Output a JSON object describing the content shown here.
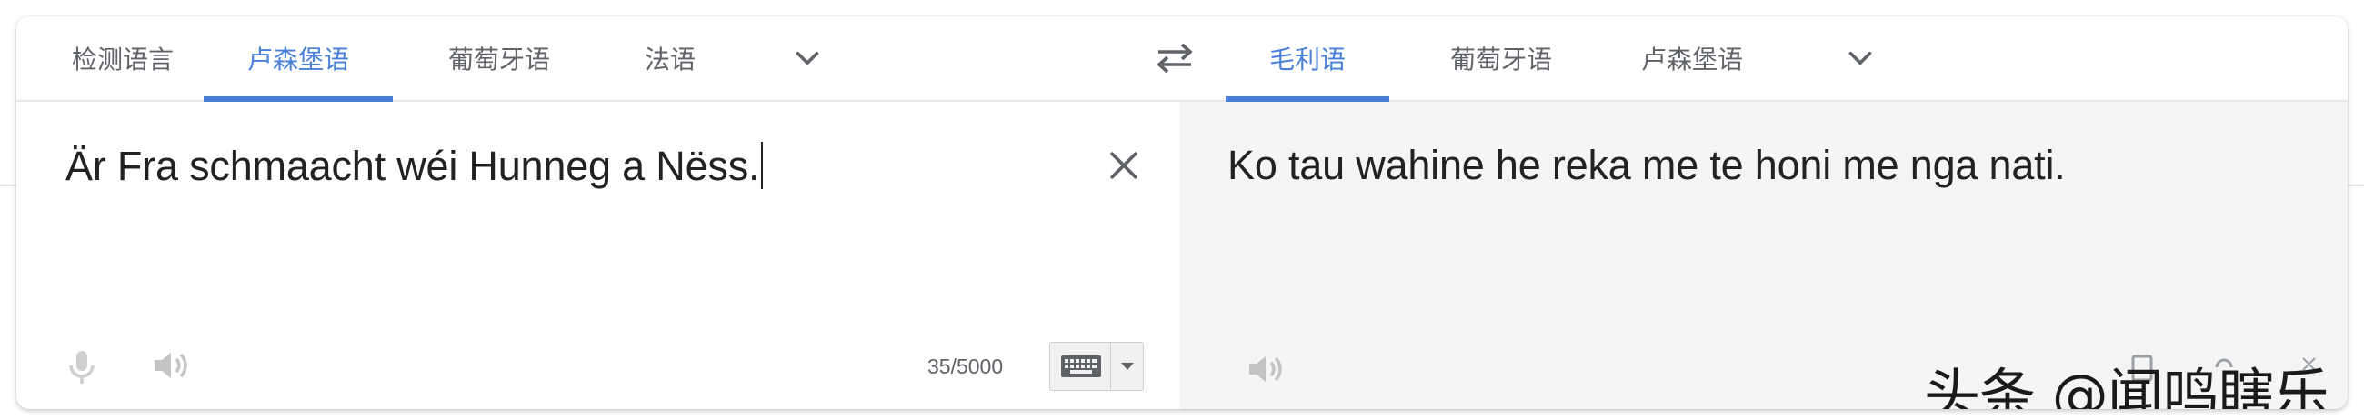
{
  "source_langs": {
    "tabs": [
      {
        "label": "检测语言",
        "active": false
      },
      {
        "label": "卢森堡语",
        "active": true
      },
      {
        "label": "葡萄牙语",
        "active": false
      },
      {
        "label": "法语",
        "active": false
      }
    ]
  },
  "target_langs": {
    "tabs": [
      {
        "label": "毛利语",
        "active": true
      },
      {
        "label": "葡萄牙语",
        "active": false
      },
      {
        "label": "卢森堡语",
        "active": false
      }
    ]
  },
  "source": {
    "text": "Är Fra schmaacht wéi Hunneg a Nëss.",
    "char_count": "35/5000"
  },
  "target": {
    "text": "Ko tau wahine he reka me te honi me nga nati."
  },
  "watermark": {
    "text": "头条 @闻鸣瞎乐"
  },
  "icons": {
    "swap": "swap-languages-icon",
    "chevron": "chevron-down-icon",
    "clear": "close-icon",
    "mic": "microphone-icon",
    "speaker": "speaker-icon",
    "keyboard": "keyboard-icon"
  },
  "colors": {
    "accent": "#4a7fd8",
    "tab_text": "#5f6368",
    "text": "#222222",
    "target_bg": "#f5f5f5"
  }
}
